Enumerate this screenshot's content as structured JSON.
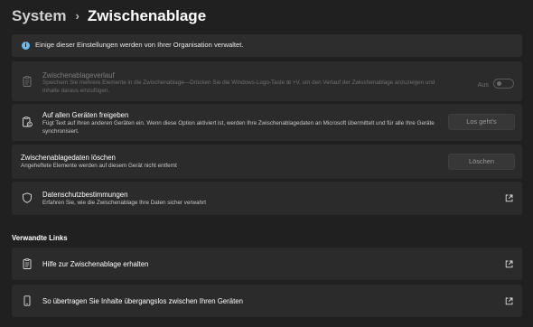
{
  "breadcrumb": {
    "parent": "System",
    "separator": "›",
    "current": "Zwischenablage"
  },
  "info_banner": {
    "icon": "info-icon",
    "text": "Einige dieser Einstellungen werden von Ihrer Organisation verwaltet."
  },
  "clipboard_history": {
    "icon": "clipboard-icon",
    "title": "Zwischenablageverlauf",
    "description": "Speichern Sie mehrere Elemente in die Zwischenablage—Drücken Sie die Windows-Logo-Taste ⊞ +V, um den Verlauf der Zwischenablage anzuzeigen und Inhalte daraus einzufügen.",
    "toggle_state": "Aus",
    "disabled": true
  },
  "sync_devices": {
    "icon": "clipboard-sync-icon",
    "title": "Auf allen Geräten freigeben",
    "description": "Fügt Text auf Ihren anderen Geräten ein. Wenn diese Option aktiviert ist, werden Ihre Zwischenablagedaten an Microsoft übermittelt und für alle Ihre Geräte synchronisiert.",
    "button_label": "Los geht's"
  },
  "clear_data": {
    "title": "Zwischenablagedaten löschen",
    "description": "Angeheftete Elemente werden auf diesem Gerät nicht entfernt",
    "button_label": "Löschen"
  },
  "privacy": {
    "icon": "shield-icon",
    "title": "Datenschutzbestimmungen",
    "description": "Erfahren Sie, wie die Zwischenablage Ihre Daten sicher verwahrt"
  },
  "related_links": {
    "heading": "Verwandte Links",
    "items": [
      {
        "icon": "clipboard-list-icon",
        "label": "Hilfe zur Zwischenablage erhalten"
      },
      {
        "icon": "phone-icon",
        "label": "So übertragen Sie Inhalte übergangslos zwischen Ihren Geräten"
      }
    ]
  },
  "colors": {
    "background": "#202020",
    "card": "#2b2b2b",
    "info_accent": "#6cb8f0"
  }
}
